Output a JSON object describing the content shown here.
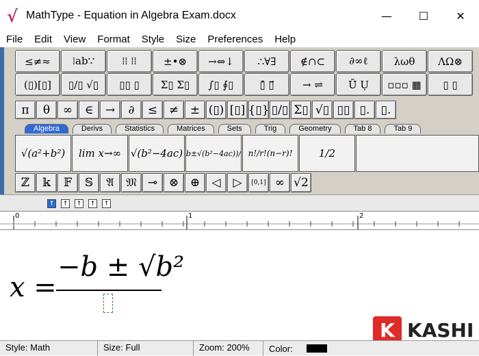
{
  "window": {
    "title": "MathType - Equation in Algebra Exam.docx",
    "logo": "√",
    "minimize": "—",
    "maximize": "☐",
    "close": "✕"
  },
  "menu": [
    "File",
    "Edit",
    "View",
    "Format",
    "Style",
    "Size",
    "Preferences",
    "Help"
  ],
  "toolbar": {
    "row1": [
      "≤≠≈",
      "⁞ab∵",
      "⁞⁞ ⁞⁞",
      "±•⊗",
      "→⇔↓",
      "∴∀∃",
      "∉∩⊂",
      "∂∞ℓ",
      "λωθ",
      "ΛΩ⊗"
    ],
    "row2": [
      "(▯)[▯]",
      "▯/▯ √▯",
      "▯▯ ▯",
      "Σ▯ Σ▯",
      "∫▯ ∮▯",
      "▯̄ ▯⃗",
      "→ ⇌",
      "Ū̇ Ụ",
      "▫▫▫ ▦",
      "▯ ▯"
    ],
    "row3": [
      "π",
      "θ",
      "∞",
      "∈",
      "→",
      "∂",
      "≤",
      "≠",
      "±",
      "(▯)",
      "[▯]",
      "{▯}",
      "▯/▯",
      "Σ▯",
      "√▯",
      "▯▯",
      "▯.",
      "▯."
    ],
    "tabs": [
      "Algebra",
      "Derivs",
      "Statistics",
      "Matrices",
      "Sets",
      "Trig",
      "Geometry",
      "Tab 8",
      "Tab 9"
    ],
    "templates": [
      "√(a²+b²)",
      "lim x→∞",
      "√(b²−4ac)",
      "(−b±√(b²−4ac))/2a",
      "n!/r!(n−r)!",
      "1/2"
    ],
    "row5": [
      "ℤ",
      "𝕜",
      "𝔽",
      "𝕊",
      "𝔄",
      "𝔐",
      "⊸",
      "⊗",
      "⊕",
      "◁",
      "▷",
      "[0,1]",
      "∞",
      "√2"
    ]
  },
  "equation": {
    "lhs": "x =",
    "numerator": "−b ± √b²"
  },
  "ruler": {
    "marks": [
      "0",
      "1",
      "2"
    ]
  },
  "status": {
    "style": "Style: Math",
    "size": "Size: Full",
    "zoom": "Zoom: 200%",
    "color": "Color:",
    "color_value": "#000000"
  },
  "watermark": {
    "mark": "K",
    "brand": "KASHI"
  }
}
